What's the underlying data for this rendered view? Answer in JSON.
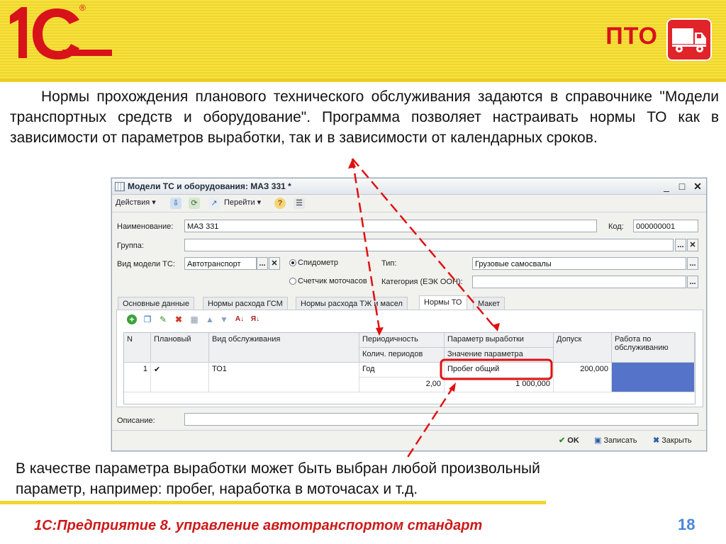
{
  "header": {
    "logo_text": "1С",
    "logo_reg": "®",
    "section_label": "ПТО"
  },
  "slide": {
    "paragraph": "Нормы прохождения планового технического обслуживания задаются в справочнике \"Модели транспортных средств и оборудование\". Программа позволяет настраивать нормы ТО как в зависимости от параметров выработки, так и в зависимости от календарных сроков.",
    "bottom_note": "В качестве параметра выработки может быть выбран любой произвольный параметр, например: пробег, наработка в моточасах и т.д.",
    "footer_title": "1С:Предприятие 8. управление автотранспортом стандарт",
    "page_number": "18"
  },
  "window": {
    "title": "Модели ТС и оборудования: МАЗ 331 *",
    "controls": {
      "minimize": "_",
      "maximize": "□",
      "close": "✕"
    },
    "toolbar": {
      "actions": "Действия",
      "goto": "Перейти",
      "help": "?"
    },
    "form": {
      "name_label": "Наименование:",
      "name_value": "МАЗ 331",
      "code_label": "Код:",
      "code_value": "000000001",
      "group_label": "Группа:",
      "group_value": "",
      "model_label": "Вид модели ТС:",
      "model_value": "Автотранспорт",
      "speedometer": "Спидометр",
      "hours_counter": "Счетчик моточасов",
      "type_label": "Тип:",
      "type_value": "Грузовые самосвалы",
      "category_label": "Категория (ЕЭК ООН):",
      "category_value": "",
      "ellipsis": "...",
      "clear": "✕",
      "description_label": "Описание:",
      "description_value": ""
    },
    "tabs": [
      "Основные данные",
      "Нормы расхода ГСМ",
      "Нормы расхода ТЖ и масел",
      "Нормы ТО",
      "Макет"
    ],
    "grid": {
      "headers": {
        "n": "N",
        "planned": "Плановый",
        "service": "Вид обслуживания",
        "periodicity": "Периодичность",
        "periods_count": "Колич. периодов",
        "param": "Параметр выработки",
        "param_value": "Значение параметра",
        "tolerance": "Допуск",
        "works": "Работа по обслуживанию"
      },
      "rows": [
        {
          "n": "1",
          "planned": "✔",
          "service": "ТО1",
          "periodicity": "Год",
          "periods_count": "2,00",
          "param": "Пробег общий",
          "param_value": "1 000,000",
          "tolerance": "200,000",
          "works": ""
        }
      ]
    },
    "buttons": {
      "ok": "OK",
      "save": "Записать",
      "close": "Закрыть"
    }
  },
  "colors": {
    "brand_red": "#d8121b",
    "header_yellow": "#f0d62d",
    "annotation_red": "#e01010",
    "selected_cell": "#5574c9",
    "page_number_blue": "#4a86d8"
  }
}
